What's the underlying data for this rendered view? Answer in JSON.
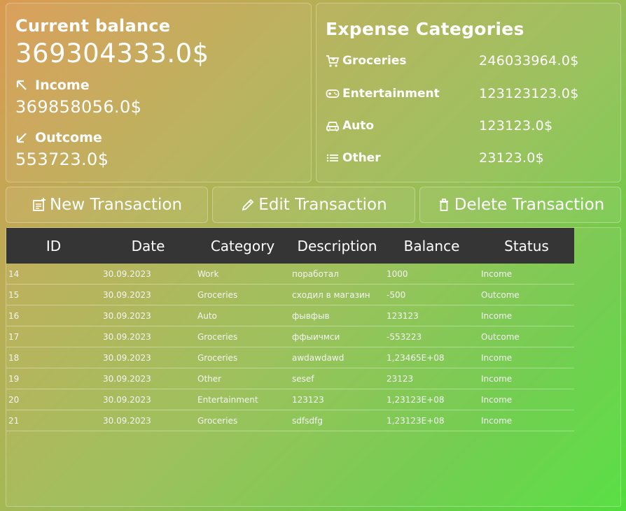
{
  "balance": {
    "title": "Current balance",
    "value": "369304333.0$",
    "income_label": "Income",
    "income_value": "369858056.0$",
    "outcome_label": "Outcome",
    "outcome_value": "553723.0$"
  },
  "categories": {
    "title": "Expense Categories",
    "items": [
      {
        "icon": "cart-icon",
        "name": "Groceries",
        "amount": "246033964.0$"
      },
      {
        "icon": "gamepad-icon",
        "name": "Entertainment",
        "amount": "123123123.0$"
      },
      {
        "icon": "car-icon",
        "name": "Auto",
        "amount": "123123.0$"
      },
      {
        "icon": "list-icon",
        "name": "Other",
        "amount": "23123.0$"
      }
    ]
  },
  "actions": {
    "new": "New Transaction",
    "edit": "Edit Transaction",
    "delete": "Delete Transaction"
  },
  "table": {
    "headers": [
      "ID",
      "Date",
      "Category",
      "Description",
      "Balance",
      "Status"
    ],
    "rows": [
      [
        "14",
        "30.09.2023",
        "Work",
        "поработал",
        "1000",
        "Income"
      ],
      [
        "15",
        "30.09.2023",
        "Groceries",
        "сходил в магазин",
        "-500",
        "Outcome"
      ],
      [
        "16",
        "30.09.2023",
        "Auto",
        "фывфыв",
        "123123",
        "Income"
      ],
      [
        "17",
        "30.09.2023",
        "Groceries",
        "ффыичмси",
        "-553223",
        "Outcome"
      ],
      [
        "18",
        "30.09.2023",
        "Groceries",
        "awdawdawd",
        "1,23465E+08",
        "Income"
      ],
      [
        "19",
        "30.09.2023",
        "Other",
        "sesef",
        "23123",
        "Income"
      ],
      [
        "20",
        "30.09.2023",
        "Entertainment",
        "123123",
        "1,23123E+08",
        "Income"
      ],
      [
        "21",
        "30.09.2023",
        "Groceries",
        "sdfsdfg",
        "1,23123E+08",
        "Income"
      ]
    ]
  },
  "colors": {
    "header_bg": "#353535",
    "text": "#ffffff"
  }
}
